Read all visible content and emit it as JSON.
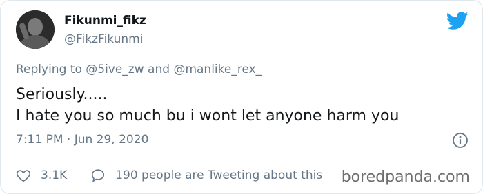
{
  "user": {
    "display_name": "Fikunmi_fikz",
    "handle": "@FikzFikunmi"
  },
  "reply": {
    "prefix": "Replying to ",
    "mention_1": "@5ive_zw",
    "joiner": " and ",
    "mention_2": "@manlike_rex_"
  },
  "tweet": {
    "line_1": "Seriously.....",
    "line_2": "I hate you so much bu i wont let anyone harm you"
  },
  "meta": {
    "timestamp": "7:11 PM · Jun 29, 2020"
  },
  "actions": {
    "like_count": "3.1K",
    "talk_text": "190 people are Tweeting about this"
  },
  "watermark": "boredpanda.com",
  "colors": {
    "twitter_blue": "#1da1f2",
    "secondary_text": "#657786",
    "primary_text": "#14171a",
    "border": "#e1e8ed"
  },
  "icons": {
    "logo": "twitter-bird-icon",
    "info": "info-icon",
    "like": "heart-icon",
    "reply": "speech-bubble-icon"
  }
}
